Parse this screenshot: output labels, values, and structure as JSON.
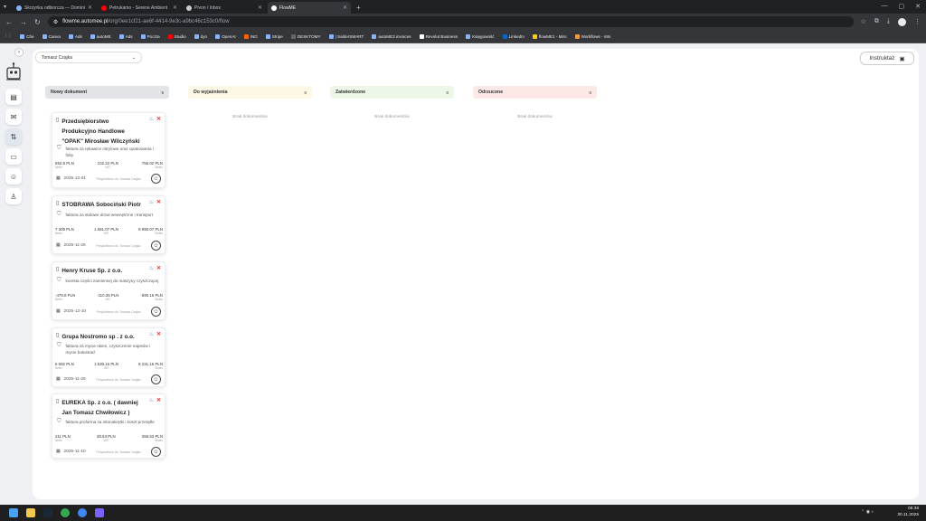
{
  "browser": {
    "tabs": [
      {
        "label": "Skrzynka odbiorcza — Dominik",
        "active": false
      },
      {
        "label": "Petrukamo - Serene Ambient",
        "active": false
      },
      {
        "label": "Pivon / Inbox",
        "active": false
      },
      {
        "label": "FlowME",
        "active": true
      }
    ],
    "new_tab": "+",
    "url_host": "flowme.automee.pl",
    "url_path": "/org/0ee1cf21-ae6f-4414-9e3c-a9bc46c153c0/flow",
    "bookmarks": [
      "Che",
      "Canva",
      "Ads",
      "autoME",
      "Ads",
      "Poczta",
      "Studio",
      "dyn",
      "OpenAI",
      "ING",
      "Stripe",
      "DESKTOMY",
      "| SalderSMART",
      "autoME3 invoices",
      "Revolut Business",
      "Księgowość",
      "LinkedIn",
      "flowME1 - Miro",
      "Workflows - n8n"
    ]
  },
  "header": {
    "owner_select": "Tomasz Czajka",
    "instructions_button": "Instruktaż"
  },
  "columns": [
    {
      "title": "Nowy dokument",
      "count": "5"
    },
    {
      "title": "Do wyjaśnienia",
      "count": "0",
      "empty_text": "Brak dokumentów"
    },
    {
      "title": "Zatwierdzone",
      "count": "0",
      "empty_text": "Brak dokumentów"
    },
    {
      "title": "Odrzucone",
      "count": "0",
      "empty_text": "Brak dokumentów"
    }
  ],
  "cards": [
    {
      "title": "Przedsiębiorstwo Produkcyjno Handlowe \"OPAK\" Mirosław Wilczyński",
      "desc": "faktura za rękawice nitrylowe oraz opakowania i folię",
      "netto": "652.8 PLN",
      "vat": "102.22 PLN",
      "brutto": "755.02 PLN",
      "date": "2025-12-01",
      "assigned": "Przydzielono do: Tomasz Czajka"
    },
    {
      "title": "STOBRAWA Sobociński Piotr",
      "desc": "faktura za stalowe drzwi wewnętrzne i transport",
      "netto": "7 309 PLN",
      "vat": "1 681.07 PLN",
      "brutto": "8 990.07 PLN",
      "date": "2025-11-26",
      "assigned": "Przydzielono do: Tomasz Czajka"
    },
    {
      "title": "Henry Kruse Sp. z o.o.",
      "desc": "korekta części zamiennej do maszyny czyszczącej",
      "netto": "-479.8 PLN",
      "vat": "-110.35 PLN",
      "brutto": "-590.15 PLN",
      "date": "2025-12-10",
      "assigned": "Przydzielono do: Tomasz Czajka"
    },
    {
      "title": "Grupa Nostromo sp . z o.o.",
      "desc": "faktura za mycie okien, czyszczenie napisów i mycie balustrad",
      "netto": "6 692 PLN",
      "vat": "1 539.16 PLN",
      "brutto": "8 231.16 PLN",
      "date": "2025-11-26",
      "assigned": "Przydzielono do: Tomasz Czajka"
    },
    {
      "title": "EUREKA Sp. z o.o. ( dawniej Jan Tomasz Chwiłowicz )",
      "desc": "faktura proforma za nitonakrętki i koszt przesyłki",
      "netto": "211 PLN",
      "vat": "48.53 PLN",
      "brutto": "259.53 PLN",
      "date": "2025-11-10",
      "assigned": "Przydzielono do: Tomasz Czajka"
    }
  ],
  "labels": {
    "netto": "Netto",
    "vat": "VAT",
    "brutto": "Brutto"
  },
  "system": {
    "time": "08:38",
    "date": "30.11.2025"
  }
}
